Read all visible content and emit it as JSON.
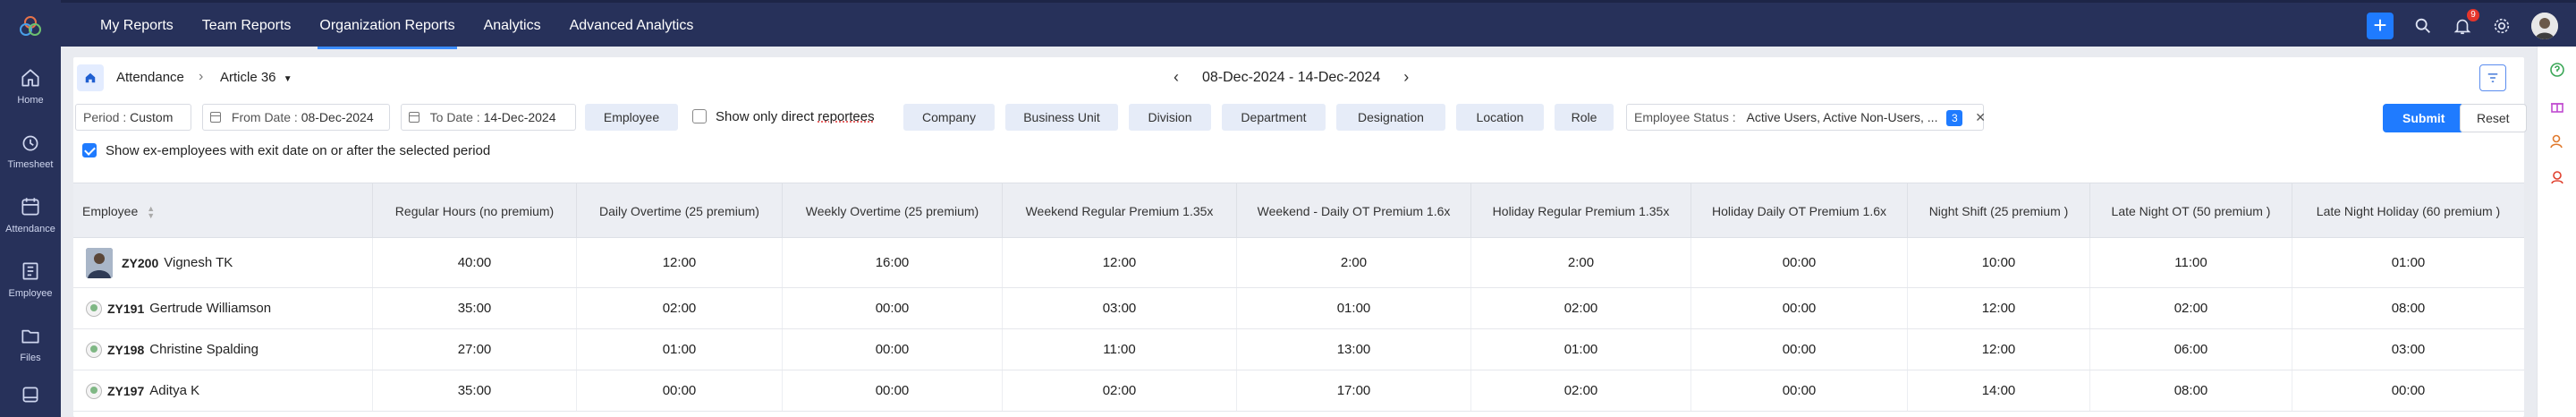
{
  "nav": {
    "tabs": [
      {
        "label": "My Reports"
      },
      {
        "label": "Team Reports"
      },
      {
        "label": "Organization Reports"
      },
      {
        "label": "Analytics"
      },
      {
        "label": "Advanced Analytics"
      }
    ],
    "active_tab": "Organization Reports",
    "notification_count": "9"
  },
  "sidebar": {
    "items": [
      {
        "label": "Home",
        "icon": "home-icon"
      },
      {
        "label": "Timesheet",
        "icon": "timesheet-icon"
      },
      {
        "label": "Attendance",
        "icon": "attendance-icon"
      },
      {
        "label": "Employee",
        "icon": "employee-icon"
      },
      {
        "label": "Files",
        "icon": "files-icon"
      },
      {
        "label": "",
        "icon": "reports-icon"
      }
    ]
  },
  "breadcrumb": {
    "module": "Attendance",
    "report": "Article 36"
  },
  "date_range": "08-Dec-2024 - 14-Dec-2024",
  "filters": {
    "period_label": "Period :",
    "period_value": "Custom",
    "from_label": "From Date :",
    "from_value": "08-Dec-2024",
    "to_label": "To Date :",
    "to_value": "14-Dec-2024",
    "employee": "Employee",
    "direct_reportees_prefix": "Show only direct ",
    "direct_reportees_word": "reportees",
    "company": "Company",
    "business_unit": "Business Unit",
    "division": "Division",
    "department": "Department",
    "designation": "Designation",
    "location": "Location",
    "role": "Role",
    "status_label": "Employee Status :",
    "status_value": "Active Users, Active Non-Users, ...",
    "status_count": "3",
    "submit": "Submit",
    "reset": "Reset"
  },
  "ex_employees_label": "Show ex-employees with exit date on or after the selected period",
  "table": {
    "columns": [
      "Employee",
      "Regular Hours (no premium)",
      "Daily Overtime (25 premium)",
      "Weekly Overtime (25 premium)",
      "Weekend Regular Premium 1.35x",
      "Weekend - Daily OT Premium 1.6x",
      "Holiday Regular Premium 1.35x",
      "Holiday Daily OT Premium 1.6x",
      "Night Shift (25 premium )",
      "Late Night OT (50 premium )",
      "Late Night Holiday (60 premium )"
    ],
    "rows": [
      {
        "id": "ZY200",
        "name": "Vignesh TK",
        "values": [
          "40:00",
          "12:00",
          "16:00",
          "12:00",
          "2:00",
          "2:00",
          "00:00",
          "10:00",
          "11:00",
          "01:00"
        ]
      },
      {
        "id": "ZY191",
        "name": "Gertrude Williamson",
        "values": [
          "35:00",
          "02:00",
          "00:00",
          "03:00",
          "01:00",
          "02:00",
          "00:00",
          "12:00",
          "02:00",
          "08:00"
        ]
      },
      {
        "id": "ZY198",
        "name": "Christine Spalding",
        "values": [
          "27:00",
          "01:00",
          "00:00",
          "11:00",
          "13:00",
          "01:00",
          "00:00",
          "12:00",
          "06:00",
          "03:00"
        ]
      },
      {
        "id": "ZY197",
        "name": "Aditya K",
        "values": [
          "35:00",
          "00:00",
          "00:00",
          "02:00",
          "17:00",
          "02:00",
          "00:00",
          "14:00",
          "08:00",
          "00:00"
        ]
      }
    ]
  },
  "colors": {
    "nav_bg": "#27315a",
    "accent": "#1f7bff",
    "header_bg": "#eceef3"
  }
}
